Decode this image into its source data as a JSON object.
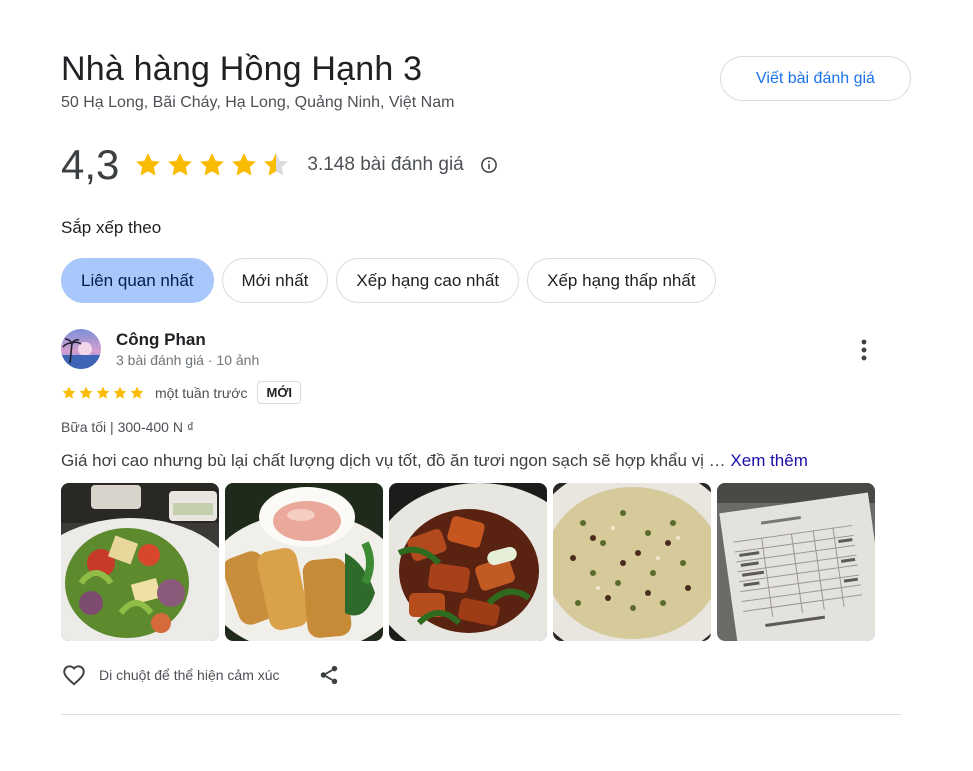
{
  "place": {
    "name": "Nhà hàng Hồng Hạnh 3",
    "address": "50 Hạ Long, Bãi Cháy, Hạ Long, Quảng Ninh, Việt Nam"
  },
  "write_review_label": "Viết bài đánh giá",
  "rating": {
    "value": "4,3",
    "stars": 4.3,
    "count_text": "3.148 bài đánh giá",
    "info_icon": "info-icon"
  },
  "sort": {
    "label": "Sắp xếp theo",
    "options": [
      "Liên quan nhất",
      "Mới nhất",
      "Xếp hạng cao nhất",
      "Xếp hạng thấp nhất"
    ],
    "selected": "Liên quan nhất"
  },
  "review": {
    "author": "Công Phan",
    "meta": "3 bài đánh giá · 10 ảnh",
    "stars": 5,
    "time": "một tuần trước",
    "badge": "MỚI",
    "attrs": "Bữa tối  |  300-400 N ₫",
    "text": "Giá hơi cao nhưng bù lại chất lượng dịch vụ tốt, đồ ăn tươi ngon sạch sẽ hợp khẩu vị …",
    "see_more": "Xem thêm",
    "photos": [
      "salad",
      "spring-rolls",
      "stir-fried-pork",
      "fried-rice",
      "receipt"
    ],
    "react_label": "Di chuột để thể hiện cảm xúc"
  },
  "colors": {
    "star": "#fbbc04",
    "chip_active": "#a8c7fa",
    "link": "#1a73e8"
  }
}
